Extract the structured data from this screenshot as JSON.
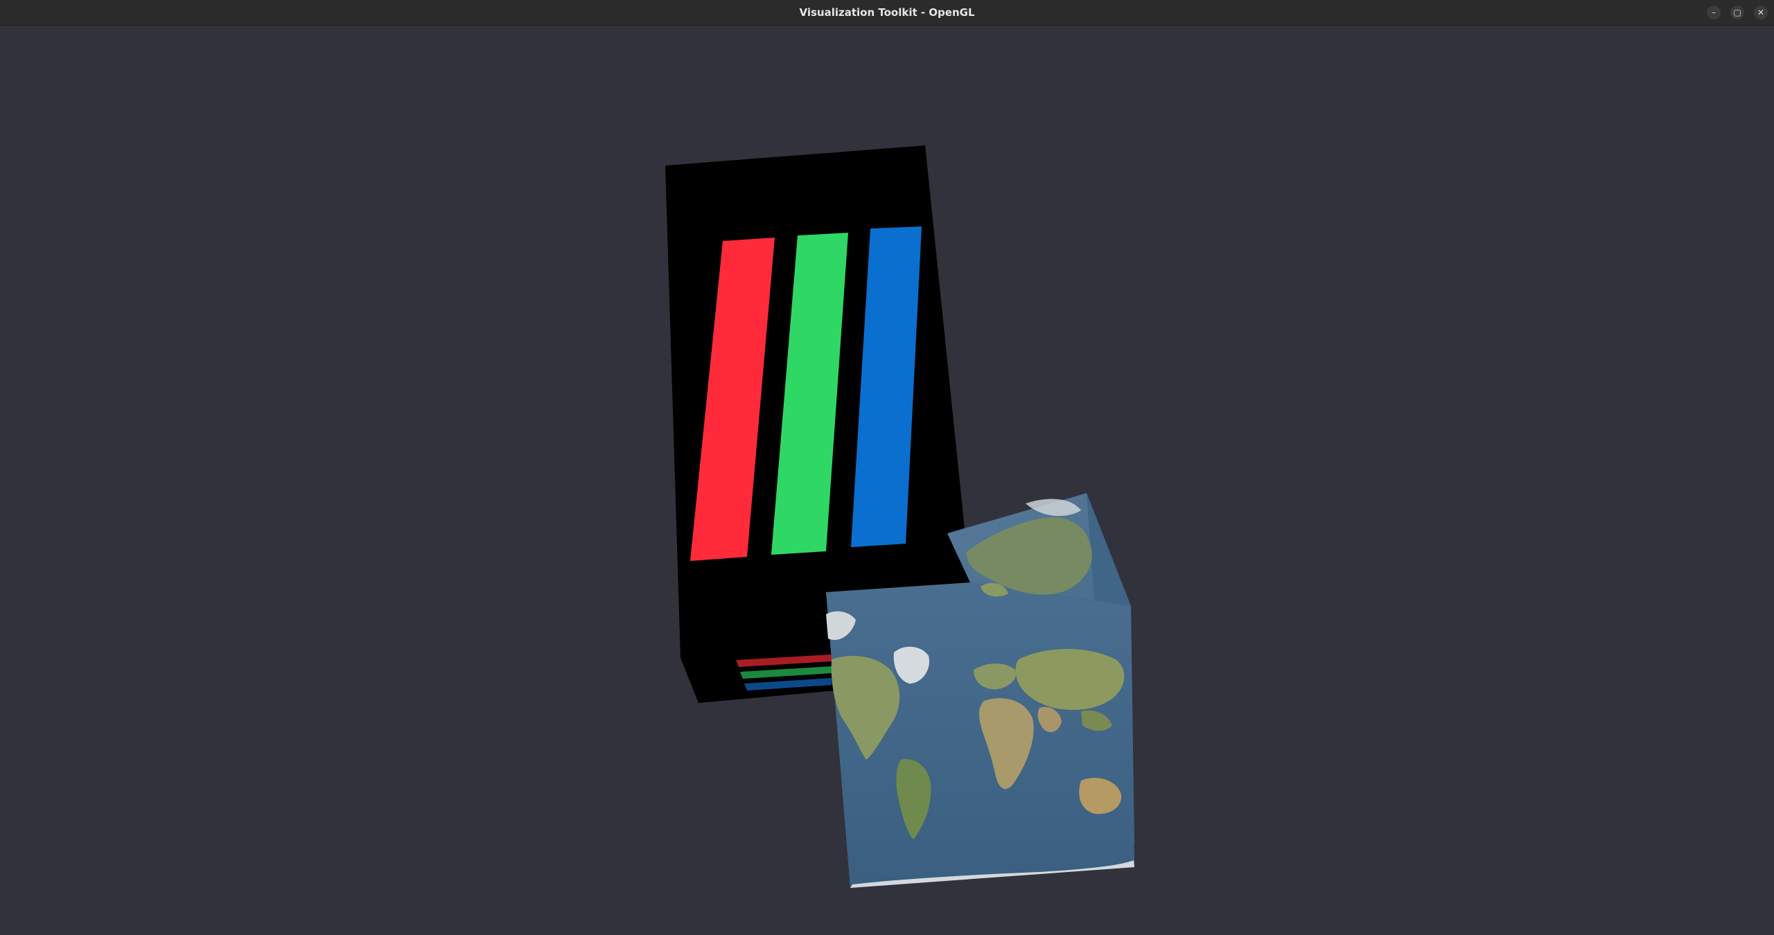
{
  "window": {
    "title": "Visualization Toolkit - OpenGL",
    "controls": {
      "minimize": "–",
      "maximize": "▢",
      "close": "✕"
    }
  },
  "viewport": {
    "background_color": "#32323c",
    "objects": [
      {
        "name": "striped-box",
        "face_color": "#000000",
        "stripe_colors": [
          "#ff2b3a",
          "#2fd864",
          "#0a6fcf"
        ]
      },
      {
        "name": "earth-textured-cube",
        "ocean_color": "#3f6587",
        "land_color": "#7c8d5c",
        "ice_color": "#cdd3d8"
      }
    ]
  }
}
